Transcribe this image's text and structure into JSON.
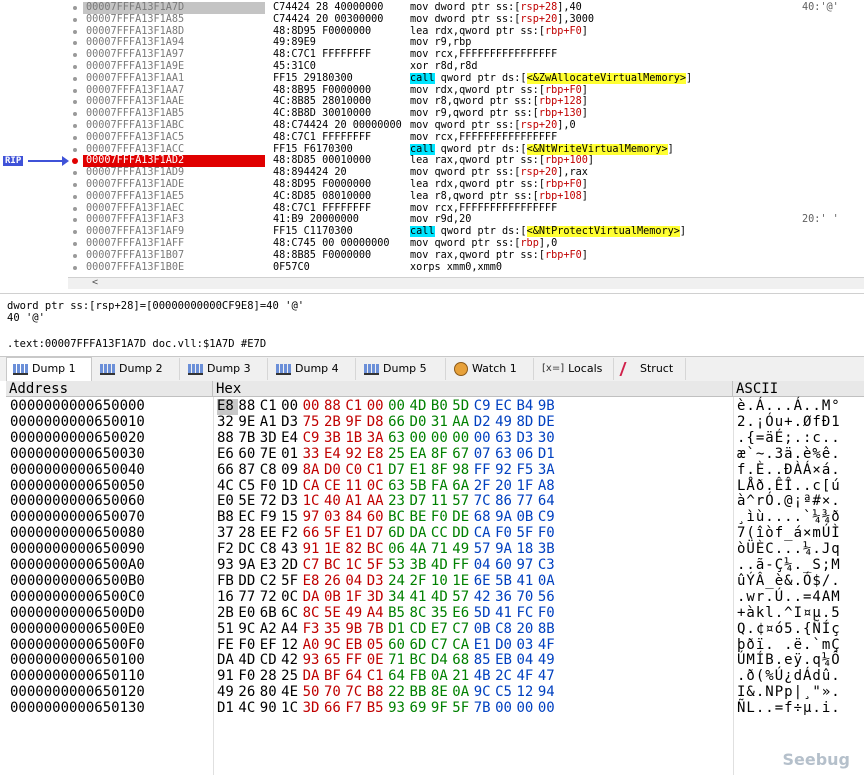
{
  "disasm": {
    "rip_label": "RIP",
    "rows": [
      {
        "addr": "00007FFFA13F1A7D",
        "bytes": "C74424 28 40000000",
        "instr": [
          {
            "t": "mov dword ptr ss:"
          },
          {
            "t": "[",
            "c": "brk"
          },
          {
            "t": "rsp+28",
            "c": "reg"
          },
          {
            "t": "],40"
          }
        ],
        "cmt": "40:'@'",
        "state": "first"
      },
      {
        "addr": "00007FFFA13F1A85",
        "bytes": "C74424 20 00300000",
        "instr": [
          {
            "t": "mov dword ptr ss:"
          },
          {
            "t": "["
          },
          {
            "t": "rsp+20",
            "c": "reg"
          },
          {
            "t": "],3000"
          }
        ],
        "cmt": ""
      },
      {
        "addr": "00007FFFA13F1A8D",
        "bytes": "48:8D95 F0000000",
        "instr": [
          {
            "t": "lea rdx,qword ptr ss:"
          },
          {
            "t": "["
          },
          {
            "t": "rbp+F0",
            "c": "reg"
          },
          {
            "t": "]"
          }
        ],
        "cmt": ""
      },
      {
        "addr": "00007FFFA13F1A94",
        "bytes": "49:89E9",
        "instr": [
          {
            "t": "mov r9,rbp"
          }
        ],
        "cmt": ""
      },
      {
        "addr": "00007FFFA13F1A97",
        "bytes": "48:C7C1 FFFFFFFF",
        "instr": [
          {
            "t": "mov rcx,FFFFFFFFFFFFFFFF"
          }
        ],
        "cmt": ""
      },
      {
        "addr": "00007FFFA13F1A9E",
        "bytes": "45:31C0",
        "instr": [
          {
            "t": "xor r8d,r8d"
          }
        ],
        "cmt": ""
      },
      {
        "addr": "00007FFFA13F1AA1",
        "bytes": "FF15 29180300",
        "instr": [
          {
            "t": "call",
            "c": "kw-call"
          },
          {
            "t": " qword ptr ds:["
          },
          {
            "t": "<&ZwAllocateVirtualMemory>",
            "c": "sym"
          },
          {
            "t": "]"
          }
        ],
        "cmt": ""
      },
      {
        "addr": "00007FFFA13F1AA7",
        "bytes": "48:8B95 F0000000",
        "instr": [
          {
            "t": "mov rdx,qword ptr ss:"
          },
          {
            "t": "["
          },
          {
            "t": "rbp+F0",
            "c": "reg"
          },
          {
            "t": "]"
          }
        ],
        "cmt": ""
      },
      {
        "addr": "00007FFFA13F1AAE",
        "bytes": "4C:8B85 28010000",
        "instr": [
          {
            "t": "mov r8,qword ptr ss:"
          },
          {
            "t": "["
          },
          {
            "t": "rbp+128",
            "c": "reg"
          },
          {
            "t": "]"
          }
        ],
        "cmt": ""
      },
      {
        "addr": "00007FFFA13F1AB5",
        "bytes": "4C:8B8D 30010000",
        "instr": [
          {
            "t": "mov r9,qword ptr ss:"
          },
          {
            "t": "["
          },
          {
            "t": "rbp+130",
            "c": "reg"
          },
          {
            "t": "]"
          }
        ],
        "cmt": ""
      },
      {
        "addr": "00007FFFA13F1ABC",
        "bytes": "48:C74424 20 00000000",
        "instr": [
          {
            "t": "mov qword ptr ss:"
          },
          {
            "t": "["
          },
          {
            "t": "rsp+20",
            "c": "reg"
          },
          {
            "t": "],0"
          }
        ],
        "cmt": ""
      },
      {
        "addr": "00007FFFA13F1AC5",
        "bytes": "48:C7C1 FFFFFFFF",
        "instr": [
          {
            "t": "mov rcx,FFFFFFFFFFFFFFFF"
          }
        ],
        "cmt": ""
      },
      {
        "addr": "00007FFFA13F1ACC",
        "bytes": "FF15 F6170300",
        "instr": [
          {
            "t": "call",
            "c": "kw-call"
          },
          {
            "t": " qword ptr ds:["
          },
          {
            "t": "<&NtWriteVirtualMemory>",
            "c": "sym"
          },
          {
            "t": "]"
          }
        ],
        "cmt": ""
      },
      {
        "addr": "00007FFFA13F1AD2",
        "bytes": "48:8D85 00010000",
        "instr": [
          {
            "t": "lea rax,qword ptr ss:"
          },
          {
            "t": "["
          },
          {
            "t": "rbp+100",
            "c": "reg"
          },
          {
            "t": "]"
          }
        ],
        "cmt": "",
        "state": "rip"
      },
      {
        "addr": "00007FFFA13F1AD9",
        "bytes": "48:894424 20",
        "instr": [
          {
            "t": "mov qword ptr ss:"
          },
          {
            "t": "["
          },
          {
            "t": "rsp+20",
            "c": "reg"
          },
          {
            "t": "],rax"
          }
        ],
        "cmt": ""
      },
      {
        "addr": "00007FFFA13F1ADE",
        "bytes": "48:8D95 F0000000",
        "instr": [
          {
            "t": "lea rdx,qword ptr ss:"
          },
          {
            "t": "["
          },
          {
            "t": "rbp+F0",
            "c": "reg"
          },
          {
            "t": "]"
          }
        ],
        "cmt": ""
      },
      {
        "addr": "00007FFFA13F1AE5",
        "bytes": "4C:8D85 08010000",
        "instr": [
          {
            "t": "lea r8,qword ptr ss:"
          },
          {
            "t": "["
          },
          {
            "t": "rbp+108",
            "c": "reg"
          },
          {
            "t": "]"
          }
        ],
        "cmt": ""
      },
      {
        "addr": "00007FFFA13F1AEC",
        "bytes": "48:C7C1 FFFFFFFF",
        "instr": [
          {
            "t": "mov rcx,FFFFFFFFFFFFFFFF"
          }
        ],
        "cmt": ""
      },
      {
        "addr": "00007FFFA13F1AF3",
        "bytes": "41:B9 20000000",
        "instr": [
          {
            "t": "mov r9d,20"
          }
        ],
        "cmt": "20:' '"
      },
      {
        "addr": "00007FFFA13F1AF9",
        "bytes": "FF15 C1170300",
        "instr": [
          {
            "t": "call",
            "c": "kw-call"
          },
          {
            "t": " qword ptr ds:["
          },
          {
            "t": "<&NtProtectVirtualMemory>",
            "c": "sym"
          },
          {
            "t": "]"
          }
        ],
        "cmt": ""
      },
      {
        "addr": "00007FFFA13F1AFF",
        "bytes": "48:C745 00 00000000",
        "instr": [
          {
            "t": "mov qword ptr ss:"
          },
          {
            "t": "["
          },
          {
            "t": "rbp",
            "c": "reg"
          },
          {
            "t": "],0"
          }
        ],
        "cmt": ""
      },
      {
        "addr": "00007FFFA13F1B07",
        "bytes": "48:8B85 F0000000",
        "instr": [
          {
            "t": "mov rax,qword ptr ss:"
          },
          {
            "t": "["
          },
          {
            "t": "rbp+F0",
            "c": "reg"
          },
          {
            "t": "]"
          }
        ],
        "cmt": ""
      },
      {
        "addr": "00007FFFA13F1B0E",
        "bytes": "0F57C0",
        "instr": [
          {
            "t": "xorps xmm0,xmm0"
          }
        ],
        "cmt": ""
      }
    ],
    "scroll_left": "<"
  },
  "info": {
    "line1": "dword ptr ss:[rsp+28]=[00000000000CF9E8]=40 '@'",
    "line2": "40 '@'",
    "line3": ".text:00007FFFA13F1A7D doc.vll:$1A7D #E7D"
  },
  "tabs": [
    {
      "label": "Dump 1",
      "icon": "memory-icon",
      "active": true
    },
    {
      "label": "Dump 2",
      "icon": "memory-icon"
    },
    {
      "label": "Dump 3",
      "icon": "memory-icon"
    },
    {
      "label": "Dump 4",
      "icon": "memory-icon"
    },
    {
      "label": "Dump 5",
      "icon": "memory-icon"
    },
    {
      "label": "Watch 1",
      "icon": "watch-icon"
    },
    {
      "label": "Locals",
      "icon": "locals-icon",
      "glyph": "[x=]"
    },
    {
      "label": "Struct",
      "icon": "struct-icon"
    }
  ],
  "dump": {
    "headers": {
      "address": "Address",
      "hex": "Hex",
      "ascii": "ASCII"
    },
    "rows": [
      {
        "addr": "0000000000650000",
        "hex": [
          "E8",
          "88",
          "C1",
          "00",
          "00",
          "88",
          "C1",
          "00",
          "00",
          "4D",
          "B0",
          "5D",
          "C9",
          "EC",
          "B4",
          "9B"
        ],
        "ascii": "è.Á...Á..M°"
      },
      {
        "addr": "0000000000650010",
        "hex": [
          "32",
          "9E",
          "A1",
          "D3",
          "75",
          "2B",
          "9F",
          "D8",
          "66",
          "D0",
          "31",
          "AA",
          "D2",
          "49",
          "8D",
          "DE"
        ],
        "ascii": "2.¡Óu+.ØfÐ1"
      },
      {
        "addr": "0000000000650020",
        "hex": [
          "88",
          "7B",
          "3D",
          "E4",
          "C9",
          "3B",
          "1B",
          "3A",
          "63",
          "00",
          "00",
          "00",
          "00",
          "63",
          "D3",
          "30"
        ],
        "ascii": ".{=äÉ;.:c.."
      },
      {
        "addr": "0000000000650030",
        "hex": [
          "E6",
          "60",
          "7E",
          "01",
          "33",
          "E4",
          "92",
          "E8",
          "25",
          "EA",
          "8F",
          "67",
          "07",
          "63",
          "06",
          "D1"
        ],
        "ascii": "æ`~.3ä.è%ê."
      },
      {
        "addr": "0000000000650040",
        "hex": [
          "66",
          "87",
          "C8",
          "09",
          "8A",
          "D0",
          "C0",
          "C1",
          "D7",
          "E1",
          "8F",
          "98",
          "FF",
          "92",
          "F5",
          "3A"
        ],
        "ascii": "f.È..ÐÀÁ×á."
      },
      {
        "addr": "0000000000650050",
        "hex": [
          "4C",
          "C5",
          "F0",
          "1D",
          "CA",
          "CE",
          "11",
          "0C",
          "63",
          "5B",
          "FA",
          "6A",
          "2F",
          "20",
          "1F",
          "A8"
        ],
        "ascii": "LÅð.ÊÎ..c[ú"
      },
      {
        "addr": "0000000000650060",
        "hex": [
          "E0",
          "5E",
          "72",
          "D3",
          "1C",
          "40",
          "A1",
          "AA",
          "23",
          "D7",
          "11",
          "57",
          "7C",
          "86",
          "77",
          "64"
        ],
        "ascii": "à^rÓ.@¡ª#×."
      },
      {
        "addr": "0000000000650070",
        "hex": [
          "B8",
          "EC",
          "F9",
          "15",
          "97",
          "03",
          "84",
          "60",
          "BC",
          "BE",
          "F0",
          "DE",
          "68",
          "9A",
          "0B",
          "C9"
        ],
        "ascii": "¸ìù....`¼¾ð"
      },
      {
        "addr": "0000000000650080",
        "hex": [
          "37",
          "28",
          "EE",
          "F2",
          "66",
          "5F",
          "E1",
          "D7",
          "6D",
          "DA",
          "CC",
          "DD",
          "CA",
          "F0",
          "5F",
          "F0"
        ],
        "ascii": "7(îòf_á×mÚÌ"
      },
      {
        "addr": "0000000000650090",
        "hex": [
          "F2",
          "DC",
          "C8",
          "43",
          "91",
          "1E",
          "82",
          "BC",
          "06",
          "4A",
          "71",
          "49",
          "57",
          "9A",
          "18",
          "3B"
        ],
        "ascii": "òÜÈC...¼.Jq"
      },
      {
        "addr": "00000000006500A0",
        "hex": [
          "93",
          "9A",
          "E3",
          "2D",
          "C7",
          "BC",
          "1C",
          "5F",
          "53",
          "3B",
          "4D",
          "FF",
          "04",
          "60",
          "97",
          "C3"
        ],
        "ascii": "..ã-Ç¼._S;M"
      },
      {
        "addr": "00000000006500B0",
        "hex": [
          "FB",
          "DD",
          "C2",
          "5F",
          "E8",
          "26",
          "04",
          "D3",
          "24",
          "2F",
          "10",
          "1E",
          "6E",
          "5B",
          "41",
          "0A"
        ],
        "ascii": "ûÝÂ_è&.Ó$/."
      },
      {
        "addr": "00000000006500C0",
        "hex": [
          "16",
          "77",
          "72",
          "0C",
          "DA",
          "0B",
          "1F",
          "3D",
          "34",
          "41",
          "4D",
          "57",
          "42",
          "36",
          "70",
          "56"
        ],
        "ascii": ".wr.Ú..=4AM"
      },
      {
        "addr": "00000000006500D0",
        "hex": [
          "2B",
          "E0",
          "6B",
          "6C",
          "8C",
          "5E",
          "49",
          "A4",
          "B5",
          "8C",
          "35",
          "E6",
          "5D",
          "41",
          "FC",
          "F0"
        ],
        "ascii": "+àkl.^I¤µ.5"
      },
      {
        "addr": "00000000006500E0",
        "hex": [
          "51",
          "9C",
          "A2",
          "A4",
          "F3",
          "35",
          "9B",
          "7B",
          "D1",
          "CD",
          "E7",
          "C7",
          "0B",
          "C8",
          "20",
          "8B"
        ],
        "ascii": "Q.¢¤ó5.{ÑÍç"
      },
      {
        "addr": "00000000006500F0",
        "hex": [
          "FE",
          "F0",
          "EF",
          "12",
          "A0",
          "9C",
          "EB",
          "05",
          "60",
          "6D",
          "C7",
          "CA",
          "E1",
          "D0",
          "03",
          "4F"
        ],
        "ascii": "þðï. .ë.`mÇ"
      },
      {
        "addr": "0000000000650100",
        "hex": [
          "DA",
          "4D",
          "CD",
          "42",
          "93",
          "65",
          "FF",
          "0E",
          "71",
          "BC",
          "D4",
          "68",
          "85",
          "EB",
          "04",
          "49"
        ],
        "ascii": "ÚMÍB.eÿ.q¼Ô"
      },
      {
        "addr": "0000000000650110",
        "hex": [
          "91",
          "F0",
          "28",
          "25",
          "DA",
          "BF",
          "64",
          "C1",
          "64",
          "FB",
          "0A",
          "21",
          "4B",
          "2C",
          "4F",
          "47"
        ],
        "ascii": ".ð(%Ú¿dÁdû."
      },
      {
        "addr": "0000000000650120",
        "hex": [
          "49",
          "26",
          "80",
          "4E",
          "50",
          "70",
          "7C",
          "B8",
          "22",
          "BB",
          "8E",
          "0A",
          "9C",
          "C5",
          "12",
          "94"
        ],
        "ascii": "I&.NPp|¸\"»."
      },
      {
        "addr": "0000000000650130",
        "hex": [
          "D1",
          "4C",
          "90",
          "1C",
          "3D",
          "66",
          "F7",
          "B5",
          "93",
          "69",
          "9F",
          "5F",
          "7B",
          "00",
          "00",
          "00"
        ],
        "ascii": "ÑL..=f÷µ.i."
      }
    ]
  },
  "watermark": "Seebug"
}
